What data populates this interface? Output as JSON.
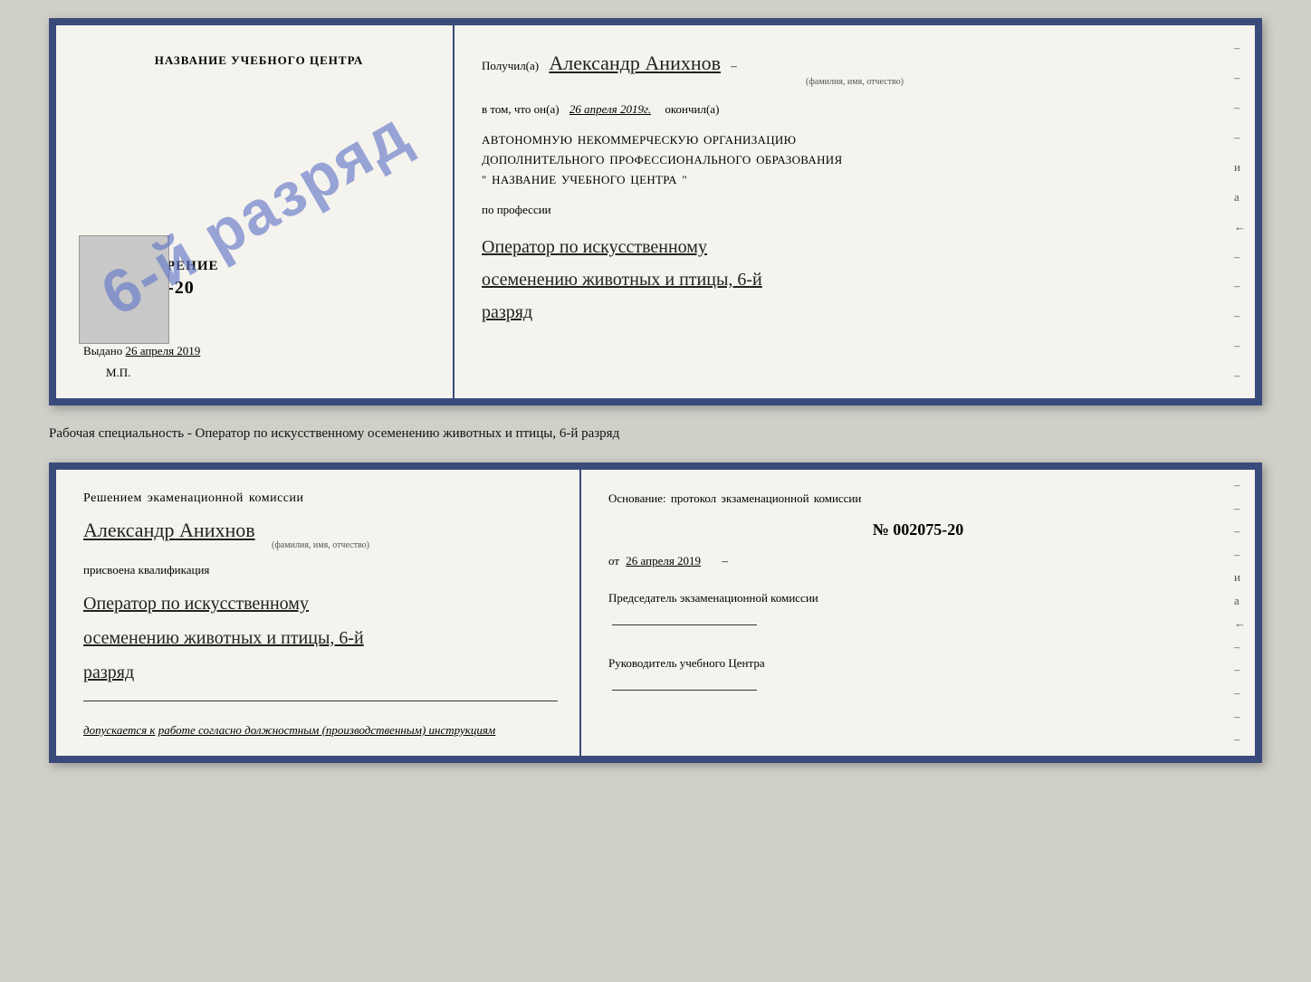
{
  "top_doc": {
    "left": {
      "center_title": "НАЗВАНИЕ УЧЕБНОГО ЦЕНТРА",
      "stamp_text": "6-й разряд",
      "cert_title": "УДОСТОВЕРЕНИЕ",
      "cert_number": "№ 002075-20",
      "issued_label": "Выдано",
      "issued_date": "26 апреля 2019",
      "mp": "М.П."
    },
    "right": {
      "received_label": "Получил(а)",
      "person_name": "Александр Анихнов",
      "person_name_sub": "(фамилия, имя, отчество)",
      "date_label": "в том, что он(а)",
      "date_value": "26 апреля 2019г.",
      "finished_label": "окончил(а)",
      "org_line1": "АВТОНОМНУЮ НЕКОММЕРЧЕСКУЮ ОРГАНИЗАЦИЮ",
      "org_line2": "ДОПОЛНИТЕЛЬНОГО ПРОФЕССИОНАЛЬНОГО ОБРАЗОВАНИЯ",
      "org_line3": "\"   НАЗВАНИЕ УЧЕБНОГО ЦЕНТРА   \"",
      "profession_label": "по профессии",
      "profession_value_line1": "Оператор по искусственному",
      "profession_value_line2": "осеменению животных и птицы, 6-й",
      "profession_value_line3": "разряд",
      "dashes": [
        "-",
        "-",
        "-",
        "-",
        "и",
        "а",
        "←",
        "-",
        "-",
        "-",
        "-",
        "-"
      ]
    }
  },
  "subtitle": "Рабочая специальность - Оператор по искусственному осеменению животных и птицы, 6-й разряд",
  "bottom_doc": {
    "left": {
      "title": "Решением экаменационной комиссии",
      "person_name": "Александр Анихнов",
      "person_name_sub": "(фамилия, имя, отчество)",
      "assigned_label": "присвоена квалификация",
      "qualification_line1": "Оператор по искусственному",
      "qualification_line2": "осеменению животных и птицы, 6-й",
      "qualification_line3": "разряд",
      "allowed_label": "допускается к",
      "allowed_value": "работе согласно должностным (производственным) инструкциям"
    },
    "right": {
      "basis_label": "Основание: протокол экзаменационной комиссии",
      "protocol_number": "№  002075-20",
      "date_label": "от",
      "date_value": "26 апреля 2019",
      "chairman_title": "Председатель экзаменационной комиссии",
      "head_title": "Руководитель учебного Центра",
      "dashes": [
        "-",
        "-",
        "-",
        "-",
        "и",
        "а",
        "←",
        "-",
        "-",
        "-",
        "-",
        "-"
      ]
    }
  }
}
